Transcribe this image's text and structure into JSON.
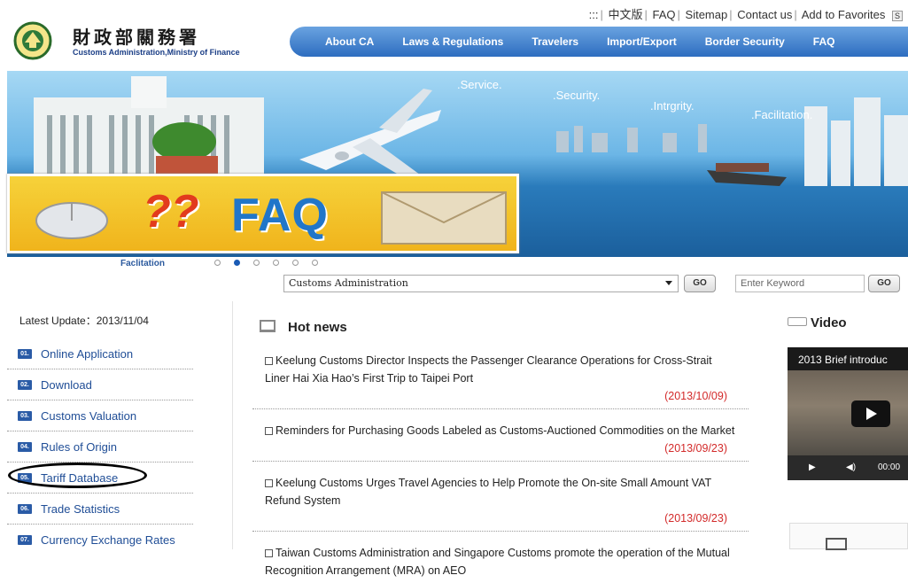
{
  "header": {
    "top_links": [
      ":::",
      "中文版",
      "FAQ",
      "Sitemap",
      "Contact us",
      "Add to Favorites"
    ],
    "search_btn_label": "S",
    "logo_zh": "財政部關務署",
    "logo_en": "Customs Administration,Ministry of Finance"
  },
  "nav": [
    "About CA",
    "Laws & Regulations",
    "Travelers",
    "Import/Export",
    "Border Security",
    "FAQ"
  ],
  "banner": {
    "slogans": [
      ".Service.",
      ".Security.",
      ".Intrgrity.",
      ".Facilitation."
    ],
    "faq_title": "FAQ",
    "faq_marks": "??",
    "caption": "Faclitation",
    "slides": 6,
    "active_slide": 2
  },
  "search": {
    "select_value": "Customs Administration",
    "go1": "GO",
    "keyword_placeholder": "Enter Keyword",
    "go2": "GO"
  },
  "sidebar": {
    "latest_update": "Latest Update：2013/11/04",
    "items": [
      {
        "num": "01.",
        "label": "Online Application"
      },
      {
        "num": "02.",
        "label": "Download"
      },
      {
        "num": "03.",
        "label": "Customs Valuation"
      },
      {
        "num": "04.",
        "label": "Rules of Origin"
      },
      {
        "num": "05.",
        "label": "Tariff Database"
      },
      {
        "num": "06.",
        "label": "Trade Statistics"
      },
      {
        "num": "07.",
        "label": "Currency Exchange Rates"
      }
    ]
  },
  "news": {
    "title": "Hot news",
    "items": [
      {
        "text": "Keelung Customs Director Inspects the Passenger Clearance Operations for Cross-Strait Liner Hai Xia Hao’s First Trip to Taipei Port",
        "date": "(2013/10/09)"
      },
      {
        "text": "Reminders for Purchasing Goods Labeled as Customs-Auctioned Commodities on the Market",
        "date": "(2013/09/23)"
      },
      {
        "text": "Keelung Customs Urges Travel Agencies to Help Promote the On-site Small Amount VAT Refund System",
        "date": "(2013/09/23)"
      },
      {
        "text": "Taiwan Customs Administration and Singapore Customs promote the operation of the Mutual Recognition Arrangement (MRA) on AEO",
        "date": ""
      }
    ]
  },
  "video": {
    "title": "Video",
    "clip_title": "2013 Brief introduc",
    "time": "00:00"
  },
  "colors": {
    "nav": "#2d6dc0",
    "link": "#1f4d96",
    "date": "#d32a2a"
  }
}
